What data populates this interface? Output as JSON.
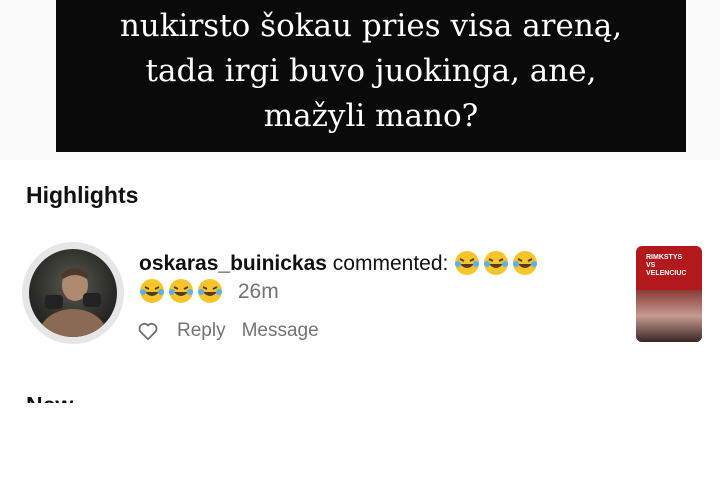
{
  "caption": {
    "lines": [
      "nukirsto šokau pries visa areną,",
      "tada irgi buvo juokinga, ane,",
      "mažyli mano?"
    ]
  },
  "highlights": {
    "title": "Highlights",
    "item": {
      "username": "oskaras_buinickas",
      "action": "commented:",
      "time": "26m",
      "reply_label": "Reply",
      "message_label": "Message",
      "thumbnail_text": [
        "RIMKSTYS",
        "VS",
        "VELENCIUC"
      ]
    }
  },
  "next_section": {
    "title": "New"
  },
  "colors": {
    "caption_bg": "#0a0a0a",
    "secondary_text": "#737373",
    "thumb_bg": "#b3181d"
  }
}
